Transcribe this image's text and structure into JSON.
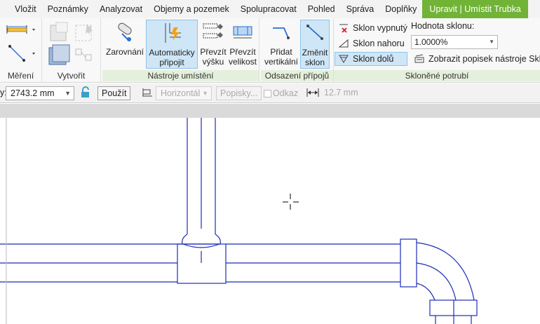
{
  "tabs": [
    "Vložit",
    "Poznámky",
    "Analyzovat",
    "Objemy a pozemek",
    "Spolupracovat",
    "Pohled",
    "Správa",
    "Doplňky",
    "Upravit | Umístit Trubka"
  ],
  "panels": {
    "mereni": "Měření",
    "vytvorit": "Vytvořit",
    "nastroje": "Nástroje umístění",
    "odsazeni": "Odsazení přípojů",
    "sklonene": "Skloněné potrubí"
  },
  "buttons": {
    "zarovnani": "Zarovnání",
    "auto_line1": "Automaticky",
    "auto_line2": "připojit",
    "vysku_line1": "Převzít",
    "vysku_line2": "výšku",
    "velikost_line1": "Převzít",
    "velikost_line2": "velikost",
    "pridat_line1": "Přidat",
    "pridat_line2": "vertikální",
    "zmenit_line1": "Změnit",
    "zmenit_line2": "sklon"
  },
  "slope": {
    "off": "Sklon vypnutý",
    "up": "Sklon nahoru",
    "down": "Sklon dolů",
    "value_label": "Hodnota sklonu:",
    "value": "1.0000%",
    "show_tooltip": "Zobrazit popisek nástroje Sklon"
  },
  "options": {
    "prefix": "y:",
    "offset_value": "2743.2 mm",
    "apply": "Použít",
    "justification": "Horizontál",
    "tags": "Popisky...",
    "leader": "Odkaz",
    "length": "12.7 mm"
  },
  "colors": {
    "pipe_line": "#1e2bb8",
    "context_tab": "#71b337",
    "selected": "#cfe6f7"
  }
}
